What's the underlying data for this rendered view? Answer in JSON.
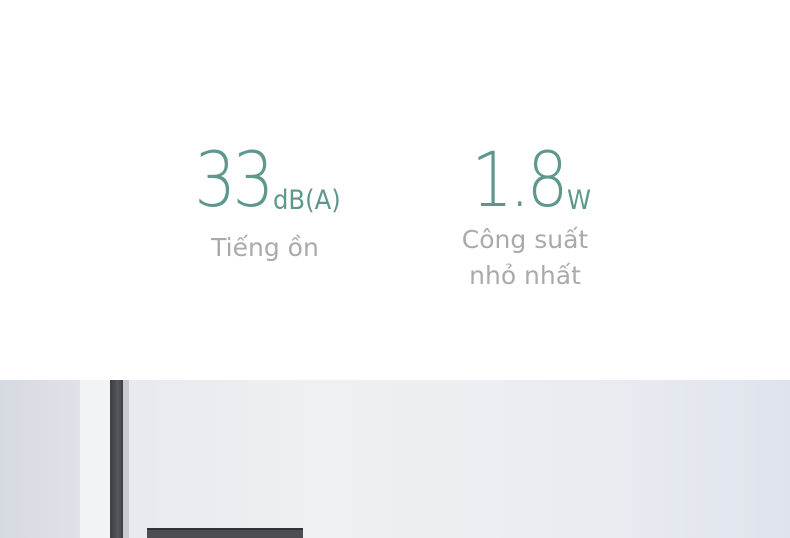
{
  "stats": {
    "noise": {
      "value": "33",
      "unit": "dB(A)",
      "label": "Tiếng ồn"
    },
    "power": {
      "value": "1.8",
      "unit": "W",
      "label_line1": "Công suất",
      "label_line2": "nhỏ nhất"
    }
  },
  "colors": {
    "accent": "#5e978d",
    "label": "#a9aaab"
  }
}
